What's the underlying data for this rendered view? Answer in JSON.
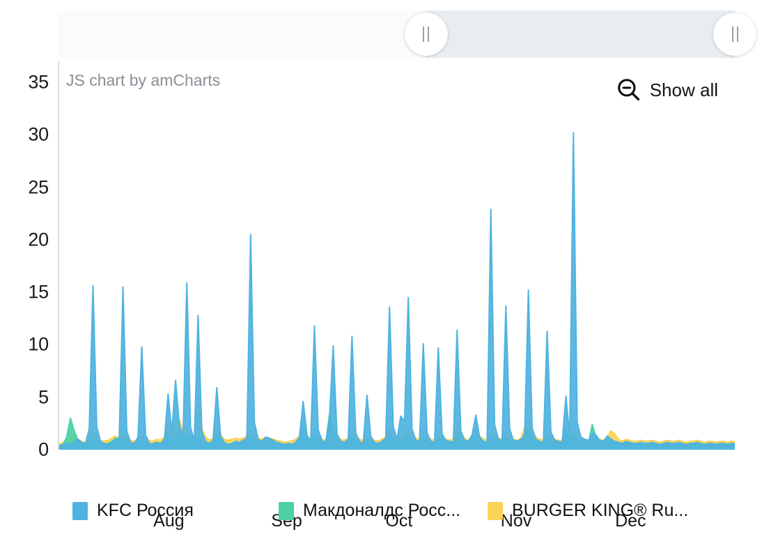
{
  "scrollbar": {
    "left_grip_label": "drag-handle",
    "right_grip_label": "drag-handle",
    "selection_start_pct": 54.4,
    "selection_end_pct": 100
  },
  "watermark": "JS chart by amCharts",
  "show_all": {
    "label": "Show all",
    "icon": "zoom-out-icon"
  },
  "legend": {
    "items": [
      {
        "label": "KFC Россия",
        "color": "#4fb3e0"
      },
      {
        "label": "Макдоналдс Росс...",
        "color": "#4dd0a4"
      },
      {
        "label": "BURGER KING® Ru...",
        "color": "#fbd256"
      }
    ]
  },
  "chart_data": {
    "type": "area",
    "title": "",
    "subtitle": "",
    "xlabel": "",
    "ylabel": "",
    "grid": false,
    "legend_position": "bottom",
    "ylim": [
      0,
      37
    ],
    "yticks": [
      0,
      5,
      10,
      15,
      20,
      25,
      30,
      35
    ],
    "xticks": [
      "Aug",
      "Sep",
      "Oct",
      "Nov",
      "Dec"
    ],
    "xtick_positions_pct": [
      16.4,
      33.8,
      50.4,
      67.7,
      84.6
    ],
    "x_count": 180,
    "colors": {
      "kfc": "#4fb3e0",
      "mcdonalds": "#4dd0a4",
      "burgerking": "#fbd256"
    },
    "series": [
      {
        "name": "KFC Россия",
        "color": "#4fb3e0",
        "values": [
          0.4,
          0.5,
          0.6,
          0.5,
          0.8,
          1.0,
          0.7,
          0.6,
          2.0,
          15.6,
          2.2,
          0.8,
          0.6,
          0.5,
          0.7,
          0.9,
          1.2,
          15.5,
          1.8,
          0.7,
          0.6,
          1.2,
          9.8,
          1.4,
          0.6,
          0.5,
          0.7,
          0.6,
          0.8,
          5.3,
          1.6,
          6.6,
          2.4,
          1.3,
          15.9,
          2.1,
          0.9,
          12.8,
          1.7,
          0.8,
          0.6,
          0.9,
          5.9,
          1.3,
          0.7,
          0.5,
          0.6,
          0.8,
          0.7,
          0.9,
          1.1,
          20.5,
          2.6,
          1.0,
          0.8,
          1.2,
          1.1,
          0.9,
          0.7,
          0.6,
          0.5,
          0.6,
          0.5,
          0.7,
          1.2,
          4.6,
          1.4,
          0.8,
          11.8,
          1.9,
          0.9,
          0.7,
          3.0,
          9.9,
          1.5,
          0.8,
          0.7,
          1.0,
          10.8,
          1.6,
          0.8,
          0.6,
          5.2,
          1.3,
          0.7,
          0.6,
          0.8,
          1.1,
          13.6,
          2.2,
          1.0,
          3.2,
          2.7,
          14.5,
          2.0,
          0.9,
          0.8,
          10.1,
          1.6,
          0.8,
          0.7,
          9.7,
          1.5,
          0.9,
          0.8,
          0.7,
          11.4,
          1.8,
          0.9,
          0.8,
          1.4,
          3.3,
          1.2,
          0.8,
          0.7,
          22.9,
          2.4,
          1.0,
          0.9,
          13.7,
          2.0,
          0.9,
          0.8,
          1.0,
          1.3,
          15.2,
          2.1,
          1.0,
          0.8,
          0.7,
          11.3,
          1.7,
          0.9,
          0.8,
          0.7,
          5.1,
          1.2,
          30.2,
          2.6,
          1.2,
          1.0,
          0.9,
          1.6,
          1.4,
          0.9,
          0.8,
          1.3,
          1.0,
          0.8,
          0.7,
          0.6,
          0.8,
          0.7,
          0.6,
          0.6,
          0.7,
          0.6,
          0.6,
          0.7,
          0.6,
          0.5,
          0.6,
          0.7,
          0.6,
          0.6,
          0.7,
          0.6,
          0.5,
          0.6,
          0.6,
          0.7,
          0.6,
          0.5,
          0.6,
          0.6,
          0.5,
          0.6,
          0.6,
          0.5,
          0.6,
          0.6
        ]
      },
      {
        "name": "Макдоналдс Росс...",
        "color": "#4dd0a4",
        "values": [
          0.3,
          0.5,
          1.2,
          3.0,
          1.8,
          0.9,
          0.6,
          0.5,
          0.7,
          1.0,
          0.8,
          0.6,
          0.5,
          0.6,
          0.8,
          1.1,
          0.9,
          1.0,
          0.7,
          0.5,
          0.6,
          0.8,
          0.9,
          0.7,
          0.5,
          0.6,
          0.7,
          0.6,
          1.0,
          1.4,
          0.9,
          1.0,
          1.6,
          1.1,
          1.3,
          0.9,
          0.7,
          1.2,
          0.9,
          0.6,
          0.5,
          0.7,
          1.5,
          1.0,
          0.6,
          0.5,
          0.6,
          0.7,
          0.6,
          0.7,
          0.9,
          1.3,
          1.0,
          0.7,
          0.6,
          0.8,
          0.7,
          0.6,
          0.5,
          0.5,
          0.4,
          0.5,
          0.5,
          0.6,
          1.0,
          2.2,
          1.2,
          0.8,
          1.5,
          1.0,
          0.7,
          0.6,
          3.4,
          1.8,
          0.9,
          0.7,
          0.6,
          0.8,
          1.2,
          0.9,
          0.7,
          0.6,
          1.0,
          0.8,
          0.6,
          0.5,
          0.7,
          0.9,
          1.4,
          1.0,
          0.8,
          0.9,
          1.0,
          1.3,
          0.9,
          0.7,
          0.6,
          1.1,
          0.9,
          0.7,
          0.6,
          1.0,
          0.8,
          0.7,
          0.6,
          0.6,
          1.2,
          0.9,
          0.7,
          0.6,
          0.8,
          1.4,
          0.9,
          0.7,
          0.6,
          1.3,
          1.0,
          0.8,
          0.7,
          1.2,
          0.9,
          0.7,
          0.6,
          0.8,
          1.6,
          2.0,
          1.1,
          0.8,
          0.7,
          0.6,
          1.0,
          0.8,
          0.7,
          0.6,
          0.6,
          1.9,
          1.0,
          1.4,
          1.0,
          0.8,
          0.7,
          0.6,
          2.4,
          1.2,
          0.8,
          0.7,
          0.9,
          0.8,
          0.7,
          0.6,
          0.5,
          0.7,
          0.6,
          0.5,
          0.5,
          0.6,
          0.5,
          0.5,
          0.6,
          0.5,
          0.4,
          0.5,
          0.6,
          0.5,
          0.5,
          0.6,
          0.5,
          0.4,
          0.5,
          0.5,
          0.6,
          0.5,
          0.4,
          0.5,
          0.5,
          0.4,
          0.5,
          0.5,
          0.4,
          0.5,
          0.5
        ]
      },
      {
        "name": "BURGER KING® Ru...",
        "color": "#fbd256",
        "values": [
          0.5,
          0.7,
          0.9,
          1.1,
          1.4,
          1.0,
          0.8,
          0.7,
          0.9,
          1.9,
          1.3,
          0.9,
          0.8,
          0.9,
          1.1,
          1.3,
          1.0,
          1.5,
          1.1,
          0.9,
          0.8,
          1.0,
          1.4,
          1.1,
          0.9,
          0.8,
          1.0,
          0.9,
          1.2,
          2.6,
          1.6,
          2.3,
          2.9,
          1.8,
          2.1,
          1.5,
          1.1,
          4.9,
          2.0,
          1.2,
          0.9,
          1.1,
          2.2,
          1.4,
          1.0,
          0.9,
          1.0,
          1.1,
          1.0,
          1.1,
          1.3,
          1.8,
          1.4,
          1.1,
          1.0,
          1.2,
          1.1,
          1.0,
          0.9,
          0.8,
          0.7,
          0.8,
          0.8,
          1.0,
          1.3,
          1.7,
          1.3,
          1.0,
          1.6,
          1.2,
          1.0,
          0.9,
          2.1,
          1.6,
          1.2,
          1.0,
          0.9,
          1.1,
          1.7,
          1.3,
          1.0,
          0.9,
          1.3,
          1.1,
          0.9,
          0.8,
          1.0,
          1.2,
          1.9,
          1.4,
          1.1,
          1.3,
          1.5,
          2.0,
          1.3,
          1.1,
          1.0,
          1.6,
          1.3,
          1.0,
          0.9,
          1.5,
          1.2,
          1.0,
          0.9,
          1.0,
          2.3,
          1.4,
          1.1,
          0.9,
          1.2,
          2.0,
          1.3,
          1.0,
          0.9,
          1.8,
          1.4,
          1.1,
          1.0,
          1.7,
          1.3,
          1.0,
          0.9,
          1.1,
          2.2,
          3.1,
          1.6,
          1.2,
          1.0,
          0.9,
          1.4,
          1.1,
          1.0,
          0.9,
          0.9,
          1.5,
          1.2,
          1.9,
          1.3,
          1.1,
          1.0,
          0.9,
          1.3,
          1.1,
          1.0,
          0.9,
          1.2,
          1.8,
          1.5,
          1.0,
          0.8,
          1.0,
          0.9,
          0.8,
          0.8,
          0.9,
          0.8,
          0.8,
          0.9,
          0.8,
          0.7,
          0.8,
          0.9,
          0.8,
          0.8,
          0.9,
          0.8,
          0.7,
          0.8,
          0.8,
          0.9,
          0.8,
          0.7,
          0.8,
          0.8,
          0.7,
          0.8,
          0.8,
          0.7,
          0.8,
          0.8
        ]
      }
    ]
  }
}
